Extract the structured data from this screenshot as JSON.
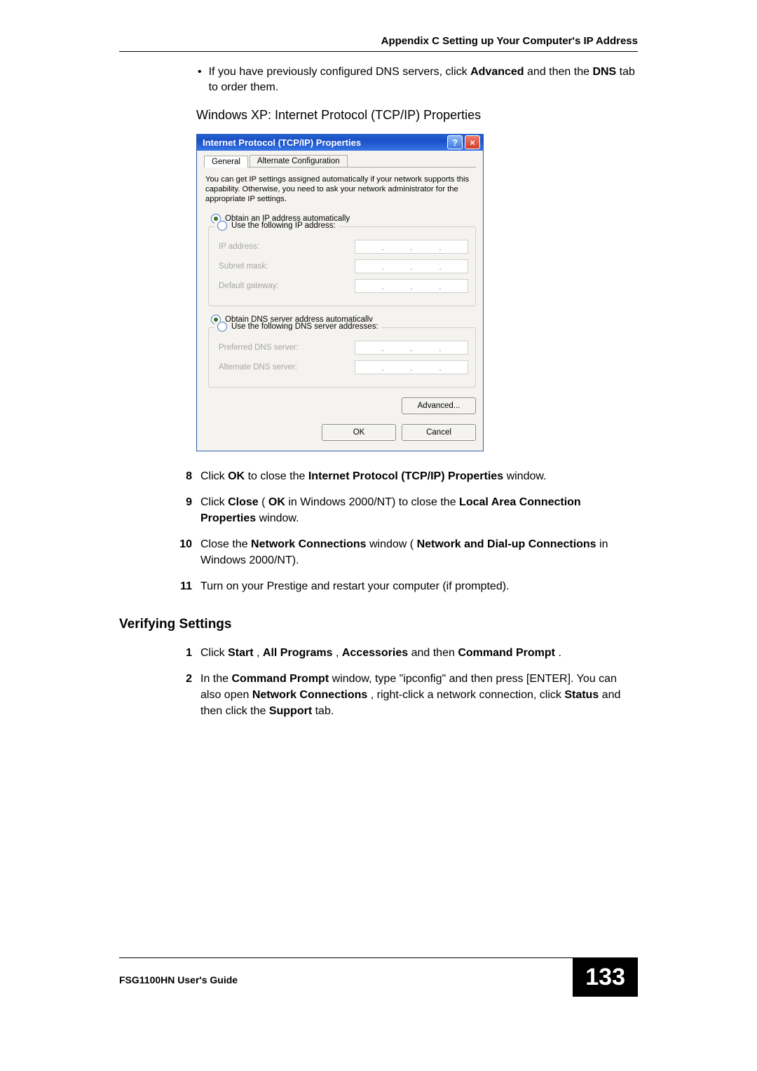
{
  "header": {
    "appendix": "Appendix C Setting up Your Computer's IP Address"
  },
  "bullet1": {
    "pre": "If you have previously configured DNS servers, click ",
    "bold1": "Advanced",
    "mid": " and then the ",
    "bold2": "DNS",
    "post": " tab to order them."
  },
  "caption": "Windows XP: Internet Protocol (TCP/IP) Properties",
  "dialog": {
    "title": "Internet Protocol (TCP/IP) Properties",
    "tabs": {
      "general": "General",
      "alt": "Alternate Configuration"
    },
    "intro": "You can get IP settings assigned automatically if your network supports this capability. Otherwise, you need to ask your network administrator for the appropriate IP settings.",
    "radio_ip_auto": "Obtain an IP address automatically",
    "radio_ip_manual": "Use the following IP address:",
    "ip_address": "IP address:",
    "subnet_mask": "Subnet mask:",
    "default_gateway": "Default gateway:",
    "radio_dns_auto": "Obtain DNS server address automatically",
    "radio_dns_manual": "Use the following DNS server addresses:",
    "pref_dns": "Preferred DNS server:",
    "alt_dns": "Alternate DNS server:",
    "advanced": "Advanced...",
    "ok": "OK",
    "cancel": "Cancel"
  },
  "steps": {
    "s8": {
      "num": "8",
      "pre": "Click ",
      "b1": "OK",
      "mid1": " to close the ",
      "b2": "Internet Protocol (TCP/IP) Properties",
      "post": " window."
    },
    "s9": {
      "num": "9",
      "pre": "Click ",
      "b1": "Close",
      "mid1": " (",
      "b2": "OK",
      "mid2": " in Windows 2000/NT) to close the ",
      "b3": "Local Area Connection Properties",
      "post": " window."
    },
    "s10": {
      "num": "10",
      "pre": "Close the ",
      "b1": "Network Connections",
      "mid1": " window (",
      "b2": "Network and Dial-up Connections",
      "post": " in Windows 2000/NT)."
    },
    "s11": {
      "num": "11",
      "text": "Turn on your Prestige and restart your computer (if prompted)."
    }
  },
  "section_heading": "Verifying Settings",
  "vsteps": {
    "s1": {
      "num": "1",
      "pre": "Click ",
      "b1": "Start",
      "c1": ", ",
      "b2": "All Programs",
      "c2": ", ",
      "b3": "Accessories",
      "mid": " and then ",
      "b4": "Command Prompt",
      "post": "."
    },
    "s2": {
      "num": "2",
      "pre": "In the ",
      "b1": "Command Prompt",
      "mid1": " window, type \"ipconfig\" and then press [ENTER]. You can also open ",
      "b2": "Network Connections",
      "mid2": ", right-click a network connection, click ",
      "b3": "Status",
      "mid3": " and then click the ",
      "b4": "Support",
      "post": " tab."
    }
  },
  "footer": {
    "guide": "FSG1100HN User's Guide",
    "page": "133"
  }
}
